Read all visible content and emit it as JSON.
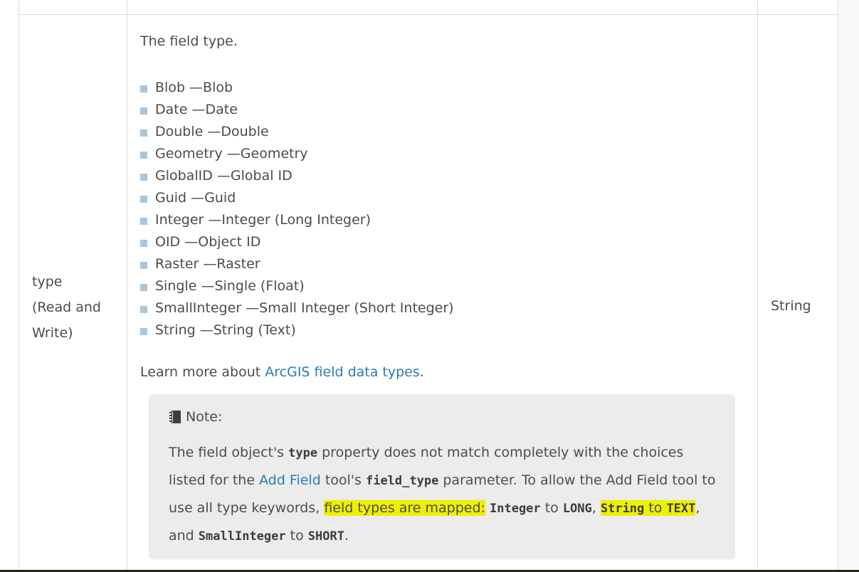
{
  "row": {
    "property": {
      "name": "type",
      "access_line1": "(Read and",
      "access_line2": "Write)"
    },
    "data_type": "String",
    "description": {
      "intro": "The field type.",
      "types": [
        {
          "key": "Blob",
          "label": "Blob"
        },
        {
          "key": "Date",
          "label": "Date"
        },
        {
          "key": "Double",
          "label": "Double"
        },
        {
          "key": "Geometry",
          "label": "Geometry"
        },
        {
          "key": "GlobalID",
          "label": "Global ID"
        },
        {
          "key": "Guid",
          "label": "Guid"
        },
        {
          "key": "Integer",
          "label": "Integer (Long Integer)"
        },
        {
          "key": "OID",
          "label": "Object ID"
        },
        {
          "key": "Raster",
          "label": "Raster"
        },
        {
          "key": "Single",
          "label": "Single (Float)"
        },
        {
          "key": "SmallInteger",
          "label": "Small Integer (Short Integer)"
        },
        {
          "key": "String",
          "label": "String (Text)"
        }
      ],
      "separator": " —",
      "learn_more_prefix": "Learn more about ",
      "learn_more_link": "ArcGIS field data types",
      "learn_more_suffix": "."
    },
    "note": {
      "icon": "notebook-icon",
      "title": "Note:",
      "t1": "The field object's ",
      "c1": "type",
      "t2": " property does not match completely with the choices listed for the ",
      "link": "Add Field",
      "t3": " tool's ",
      "c2": "field_type",
      "t4": " parameter. To allow the Add Field tool to use all type keywords, ",
      "h1": "field types are mapped:",
      "t5": " ",
      "c3": "Integer",
      "t6": " to ",
      "c4": "LONG",
      "t7": ", ",
      "c5": "String",
      "t8": " to ",
      "c6": "TEXT",
      "t9": ", and ",
      "c7": "SmallInteger",
      "t10": " to ",
      "c8": "SHORT",
      "t11": "."
    }
  },
  "colors": {
    "text": "#4c4c4c",
    "link": "#2b7bb3",
    "bullet": "#a8c6de",
    "note_bg": "#ececec",
    "highlight": "#eef000",
    "border": "#dadada"
  }
}
